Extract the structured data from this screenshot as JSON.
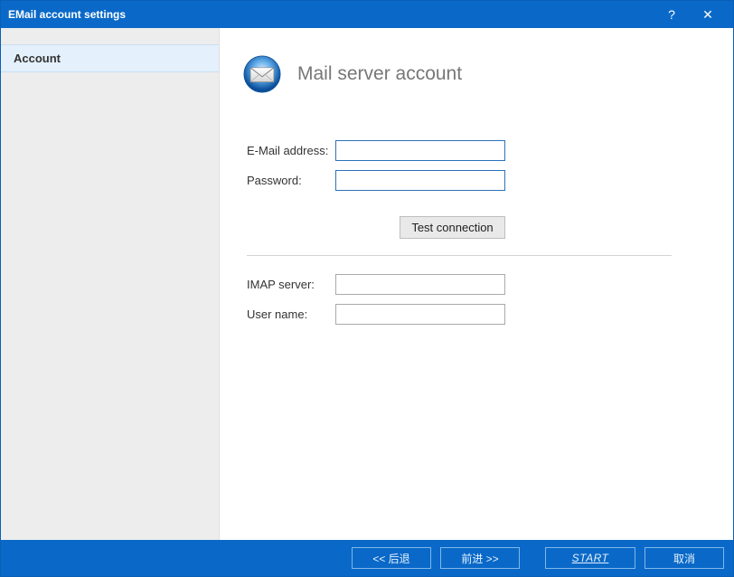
{
  "window": {
    "title": "EMail account settings"
  },
  "sidebar": {
    "items": [
      {
        "label": "Account"
      }
    ]
  },
  "page": {
    "title": "Mail server account"
  },
  "form": {
    "email_label": "E-Mail address:",
    "email_value": "",
    "password_label": "Password:",
    "password_value": "",
    "test_label": "Test connection",
    "imap_label": "IMAP server:",
    "imap_value": "",
    "username_label": "User name:",
    "username_value": ""
  },
  "footer": {
    "back": "<< 后退",
    "next": "前进 >>",
    "start": "START",
    "cancel": "取消"
  }
}
